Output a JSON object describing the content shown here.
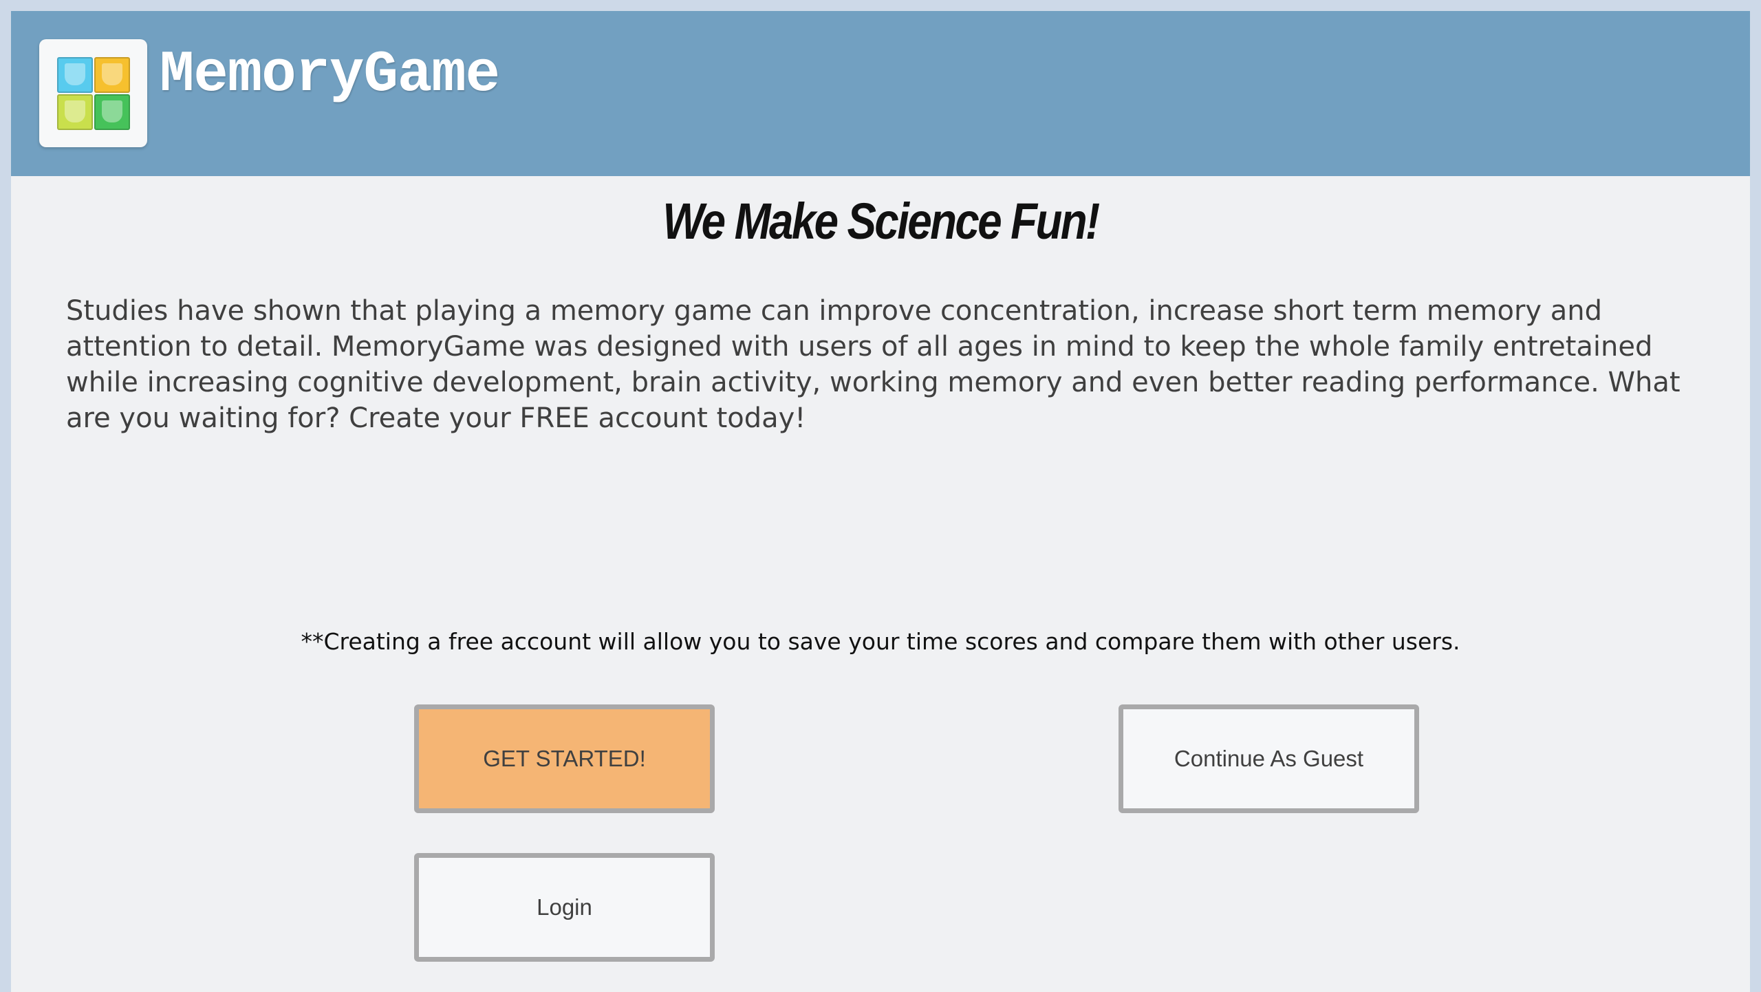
{
  "header": {
    "app_title": "MemoryGame",
    "logo_icon": "memory-cards-logo-icon",
    "colors": {
      "header_bg": "#72a0c1",
      "tile_1": "#58cbee",
      "tile_2": "#f6c02e",
      "tile_3": "#c9df4c",
      "tile_4": "#46c25a"
    }
  },
  "main": {
    "headline": "We Make Science Fun!",
    "intro": "Studies have shown that playing a memory game can improve concentration, increase short term memory and attention to detail. MemoryGame was designed with users of all ages in mind to keep the whole family entretained while increasing cognitive development, brain activity, working memory and even better reading performance. What are you waiting for? Create your FREE account today!",
    "note": "**Creating a free account will allow you to save your time scores and compare them with other users."
  },
  "buttons": {
    "get_started": "GET STARTED!",
    "continue_guest": "Continue As Guest",
    "login": "Login",
    "colors": {
      "primary_bg": "#f5b574",
      "secondary_bg": "#f6f7f9",
      "border": "#a9a9aa"
    }
  }
}
